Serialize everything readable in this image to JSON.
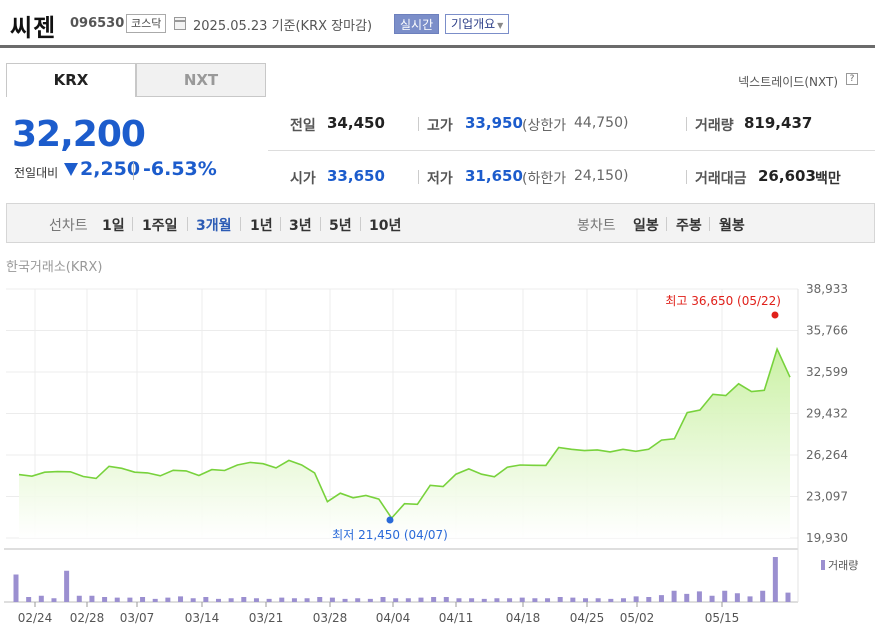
{
  "header": {
    "name": "씨젠",
    "code": "096530",
    "market": "코스닥",
    "date_text": "2025.05.23  기준(KRX 장마감)",
    "realtime_label": "실시간",
    "company_label": "기업개요"
  },
  "tabs": {
    "krx": "KRX",
    "nxt": "NXT"
  },
  "nxt_link": "넥스트레이드(NXT)",
  "help_icon": "?",
  "price": {
    "current": "32,200",
    "diff_label": "전일대비",
    "diff_value": "2,250",
    "diff_rate": "-6.53%"
  },
  "info": {
    "prev_label": "전일",
    "prev_value": "34,450",
    "high_label": "고가",
    "high_value": "33,950",
    "upper_label": "(상한가",
    "upper_value": "44,750)",
    "volume_label": "거래량",
    "volume_value": "819,437",
    "open_label": "시가",
    "open_value": "33,650",
    "low_label": "저가",
    "low_value": "31,650",
    "lower_label": "(하한가",
    "lower_value": "24,150)",
    "amount_label": "거래대금",
    "amount_value": "26,603",
    "amount_unit": "백만"
  },
  "toolbar": {
    "line_label": "선차트",
    "periods": [
      "1일",
      "1주일",
      "3개월",
      "1년",
      "3년",
      "5년",
      "10년"
    ],
    "active_period": "3개월",
    "candle_label": "봉차트",
    "candles": [
      "일봉",
      "주봉",
      "월봉"
    ]
  },
  "chart_label": "한국거래소(KRX)",
  "chart_data": {
    "type": "area",
    "y_ticks": [
      "38,933",
      "35,766",
      "32,599",
      "29,432",
      "26,264",
      "23,097",
      "19,930"
    ],
    "ylim": [
      19930,
      38933
    ],
    "x_ticks": [
      "02/24",
      "02/28",
      "03/07",
      "03/14",
      "03/21",
      "03/28",
      "04/04",
      "04/11",
      "04/18",
      "04/25",
      "05/02",
      "05/15"
    ],
    "high_annotation": "최고 36,650 (05/22)",
    "low_annotation": "최저 21,450 (04/07)",
    "volume_legend": "거래량",
    "colors": {
      "line": "#78d23c",
      "fill_top": "#c8f0a0",
      "marker_high": "#e0201a",
      "marker_low": "#2a6ad8",
      "volume": "#9b8fd0"
    },
    "prices": [
      24770,
      24650,
      24950,
      25000,
      24980,
      24620,
      24480,
      25400,
      25250,
      24950,
      24900,
      24680,
      25100,
      25050,
      24700,
      25150,
      25080,
      25500,
      25700,
      25600,
      25280,
      25850,
      25500,
      24900,
      22700,
      23350,
      23000,
      23170,
      22900,
      21450,
      22550,
      22500,
      23950,
      23850,
      24800,
      25200,
      24800,
      24600,
      25330,
      25500,
      25480,
      25470,
      26840,
      26700,
      26600,
      26650,
      26500,
      26700,
      26550,
      26700,
      27400,
      27500,
      29500,
      29700,
      30900,
      30800,
      31700,
      31100,
      31200,
      34350,
      32200
    ],
    "volumes": [
      2200,
      400,
      500,
      300,
      2500,
      500,
      500,
      400,
      350,
      350,
      400,
      250,
      350,
      450,
      300,
      400,
      250,
      300,
      400,
      300,
      250,
      350,
      300,
      300,
      400,
      350,
      250,
      300,
      250,
      400,
      300,
      300,
      350,
      400,
      400,
      300,
      300,
      250,
      300,
      300,
      350,
      300,
      300,
      400,
      350,
      300,
      300,
      250,
      300,
      450,
      400,
      550,
      900,
      650,
      850,
      500,
      900,
      700,
      450,
      900,
      3600,
      750
    ]
  }
}
